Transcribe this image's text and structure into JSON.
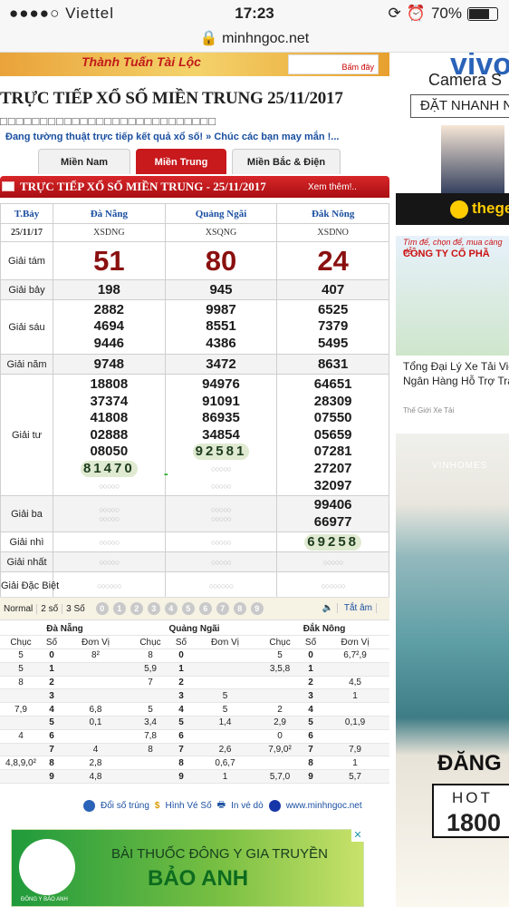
{
  "status_bar": {
    "carrier": "●●●●○ Viettel",
    "time": "17:23",
    "battery": "70%",
    "url": "minhngoc.net"
  },
  "banner_top": {
    "text": "Thành Tuấn Tài Lộc",
    "badge": "Bấm đây"
  },
  "title": "TRỰC TIẾP XỔ SỐ MIỀN TRUNG 25/11/2017",
  "boxes": "□□□□□□□□□□□□□□□□□□□□□□□□□□□",
  "ticker": "Đang tường thuật trực tiếp kết quả xổ số! » Chúc các bạn may mắn !...",
  "tabs": [
    "Miền Nam",
    "Miền Trung",
    "Miền Bắc & Điện Toán"
  ],
  "results_header": {
    "title": "TRỰC TIẾP XỔ SỐ MIỀN TRUNG - 25/11/2017",
    "more": "Xem thêm!.."
  },
  "results": {
    "day": "T.Bảy",
    "date": "25/11/17",
    "provinces": [
      {
        "name": "Đà Nẵng",
        "code": "XSDNG"
      },
      {
        "name": "Quảng Ngãi",
        "code": "XSQNG"
      },
      {
        "name": "Đắk Nông",
        "code": "XSDNO"
      }
    ],
    "labels": {
      "g8": "Giải tám",
      "g7": "Giải bảy",
      "g6": "Giải sáu",
      "g5": "Giải năm",
      "g4": "Giải tư",
      "g3": "Giải ba",
      "g2": "Giải nhì",
      "g1": "Giải nhất",
      "db": "Giải Đặc Biệt"
    },
    "loading": "○○○○○",
    "loading6": "○○○○○○",
    "g8": [
      "51",
      "80",
      "24"
    ],
    "g7": [
      "198",
      "945",
      "407"
    ],
    "g6": [
      [
        "2882",
        "4694",
        "9446"
      ],
      [
        "9987",
        "8551",
        "4386"
      ],
      [
        "6525",
        "7379",
        "5495"
      ]
    ],
    "g5": [
      "9748",
      "3472",
      "8631"
    ],
    "g4": [
      [
        "18808",
        "37374",
        "41808",
        "02888",
        "08050",
        "81470"
      ],
      [
        "94976",
        "91091",
        "86935",
        "34854",
        "92581"
      ],
      [
        "64651",
        "28309",
        "07550",
        "05659",
        "07281",
        "27207",
        "32097"
      ]
    ],
    "g3_col3": [
      "99406",
      "66977"
    ],
    "g2_col3": "69258",
    "dash": "-"
  },
  "toolbar": {
    "normal": "Normal",
    "two": "2 số",
    "three": "3 Số",
    "digits": [
      "0",
      "1",
      "2",
      "3",
      "4",
      "5",
      "6",
      "7",
      "8",
      "9"
    ],
    "tatam": "Tắt âm"
  },
  "dauduoi": {
    "provinces": [
      "Đà Nẵng",
      "Quảng Ngãi",
      "Đắk Nông"
    ],
    "head": [
      "Chục",
      "Số",
      "Đơn Vị"
    ],
    "rows": [
      [
        [
          "5",
          "0",
          "8²"
        ],
        [
          "8",
          "0",
          ""
        ],
        [
          "5",
          "0",
          "6,7²,9"
        ]
      ],
      [
        [
          "5",
          "1",
          ""
        ],
        [
          "5,9",
          "1",
          ""
        ],
        [
          "3,5,8",
          "1",
          ""
        ]
      ],
      [
        [
          "8",
          "2",
          ""
        ],
        [
          "7",
          "2",
          ""
        ],
        [
          "",
          "2",
          "4,5"
        ]
      ],
      [
        [
          "",
          "3",
          ""
        ],
        [
          "",
          "3",
          "5"
        ],
        [
          "",
          "3",
          "1"
        ]
      ],
      [
        [
          "7,9",
          "4",
          "6,8"
        ],
        [
          "5",
          "4",
          "5"
        ],
        [
          "2",
          "4",
          ""
        ]
      ],
      [
        [
          "",
          "5",
          "0,1"
        ],
        [
          "3,4",
          "5",
          "1,4"
        ],
        [
          "2,9",
          "5",
          "0,1,9"
        ]
      ],
      [
        [
          "4",
          "6",
          ""
        ],
        [
          "7,8",
          "6",
          ""
        ],
        [
          "0",
          "6",
          ""
        ]
      ],
      [
        [
          "",
          "7",
          "4"
        ],
        [
          "8",
          "7",
          "2,6"
        ],
        [
          "7,9,0²",
          "7",
          "7,9"
        ]
      ],
      [
        [
          "4,8,9,0²",
          "8",
          "2,8"
        ],
        [
          "",
          "8",
          "0,6,7"
        ],
        [
          "",
          "8",
          "1"
        ]
      ],
      [
        [
          "",
          "9",
          "4,8"
        ],
        [
          "",
          "9",
          "1"
        ],
        [
          "5,7,0",
          "9",
          "5,7"
        ]
      ]
    ]
  },
  "footer": {
    "l1": "Đổi số trúng",
    "l2": "Hình Vé Số",
    "l3": "In vé dò",
    "l4": "www.minhngoc.net"
  },
  "ad_bottom": {
    "line1": "BÀI THUỐC ĐÔNG Y GIA TRUYỀN",
    "line2": "BẢO ANH",
    "logo": "ĐÔNG Y BẢO ANH"
  },
  "sidebar": {
    "vivo": "vivo",
    "camera": "Camera S",
    "order": "ĐẶT NHANH N",
    "tgdd": "thege",
    "truck_h1": "Tìm để, chọn để, mua càng dễ ...",
    "truck_h2": "CÔNG TY CỔ PHẦ",
    "truck_text1": "Tổng Đại Lý Xe Tải Việ",
    "truck_text2": "Ngân Hàng Hỗ Trợ Trả",
    "truck_src": "Thế Giới Xe Tải",
    "vinhomes": "VINHOMES",
    "dang_ky": "ĐĂNG K",
    "hotline": "HOT",
    "phone": "1800"
  }
}
